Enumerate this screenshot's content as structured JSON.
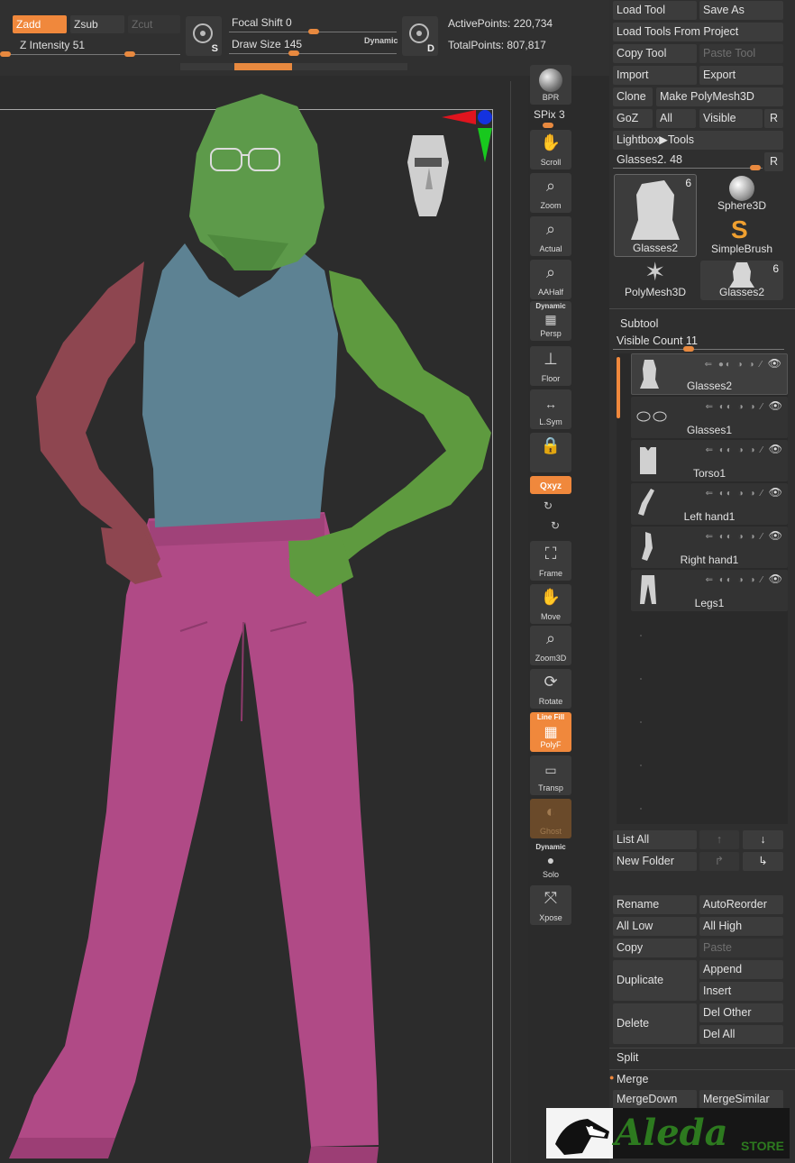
{
  "topbar": {
    "zadd": "Zadd",
    "zsub": "Zsub",
    "zcut": "Zcut",
    "z_intensity_label": "Z Intensity",
    "z_intensity_value": "51",
    "focal_shift_label": "Focal Shift",
    "focal_shift_value": "0",
    "draw_size_label": "Draw Size",
    "draw_size_value": "145",
    "dynamic": "Dynamic",
    "brush_s": "S",
    "brush_d": "D",
    "active_points_label": "ActivePoints:",
    "active_points_value": "220,734",
    "total_points_label": "TotalPoints:",
    "total_points_value": "807,817"
  },
  "shelf": {
    "bpr": "BPR",
    "spix_label": "SPix",
    "spix_value": "3",
    "scroll": "Scroll",
    "zoom": "Zoom",
    "actual": "Actual",
    "aahalf": "AAHalf",
    "dynamic": "Dynamic",
    "persp": "Persp",
    "floor": "Floor",
    "lsym": "L.Sym",
    "xyz": "Qxyz",
    "frame": "Frame",
    "move": "Move",
    "zoom3d": "Zoom3D",
    "rotate": "Rotate",
    "line_fill": "Line Fill",
    "polyf": "PolyF",
    "transp": "Transp",
    "ghost": "Ghost",
    "solo_dynamic": "Dynamic",
    "solo": "Solo",
    "xpose": "Xpose"
  },
  "panel": {
    "load_tool": "Load Tool",
    "save_as": "Save As",
    "load_from_project": "Load Tools From Project",
    "copy_tool": "Copy Tool",
    "paste_tool": "Paste Tool",
    "import": "Import",
    "export": "Export",
    "clone": "Clone",
    "make_polymesh": "Make PolyMesh3D",
    "goz": "GoZ",
    "all": "All",
    "visible": "Visible",
    "r": "R",
    "lightbox_tools": "Lightbox▶Tools",
    "current_tool": "Glasses2.",
    "current_tool_value": "48",
    "thumbs": [
      {
        "name": "Glasses2",
        "count": "6"
      },
      {
        "name": "Sphere3D",
        "count": ""
      },
      {
        "name": "SimpleBrush",
        "count": ""
      },
      {
        "name": "PolyMesh3D",
        "count": ""
      },
      {
        "name": "Glasses2",
        "count": "6"
      }
    ],
    "subtool_title": "Subtool",
    "visible_count_label": "Visible Count",
    "visible_count_value": "11",
    "subtools": [
      "Glasses2",
      "Glasses1",
      "Torso1",
      "Left hand1",
      "Right hand1",
      "Legs1"
    ],
    "list_all": "List All",
    "new_folder": "New Folder",
    "rename": "Rename",
    "autoreorder": "AutoReorder",
    "all_low": "All Low",
    "all_high": "All High",
    "copy": "Copy",
    "paste": "Paste",
    "duplicate": "Duplicate",
    "append": "Append",
    "insert": "Insert",
    "delete": "Delete",
    "del_other": "Del Other",
    "del_all": "Del All",
    "split": "Split",
    "merge": "Merge",
    "merge_down": "MergeDown",
    "merge_similar": "MergeSimilar"
  },
  "logo": {
    "word": "Aleda",
    "store": "STORE"
  },
  "colors": {
    "accent": "#f0883c",
    "skin_green": "#5d9a4a",
    "shirt_blue": "#5d8293",
    "arm_red": "#8e4650",
    "pants_pink": "#b04a86"
  }
}
